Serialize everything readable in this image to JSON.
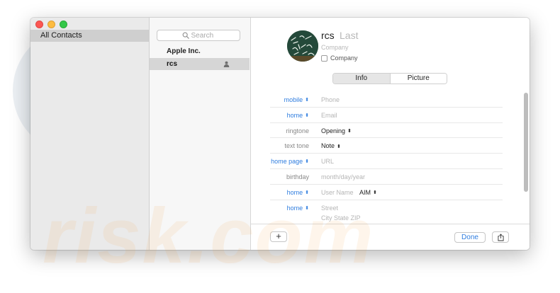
{
  "sidebar": {
    "items": [
      {
        "label": "All Contacts"
      }
    ]
  },
  "list": {
    "search_placeholder": "Search",
    "group_header": "Apple Inc.",
    "selected_contact": "rcs"
  },
  "card": {
    "first_name": "rcs",
    "last_name_placeholder": "Last",
    "company_placeholder": "Company",
    "company_checkbox_label": "Company",
    "tabs": [
      {
        "label": "Info"
      },
      {
        "label": "Picture"
      }
    ],
    "fields": [
      {
        "label": "mobile",
        "value": "Phone"
      },
      {
        "label": "home",
        "value": "Email"
      },
      {
        "label": "ringtone",
        "value": "Opening"
      },
      {
        "label": "text tone",
        "value": "Note"
      },
      {
        "label": "home page",
        "value": "URL"
      },
      {
        "label": "birthday",
        "value": "month/day/year"
      },
      {
        "label": "home",
        "value": "User Name",
        "extra": "AIM"
      },
      {
        "label": "home",
        "value": "Street",
        "value2": "City State ZIP"
      }
    ]
  },
  "toolbar": {
    "add_label": "+",
    "done_label": "Done"
  },
  "icons": {
    "search": "magnifier-icon",
    "person": "person-icon",
    "share": "share-icon"
  },
  "colors": {
    "accent": "#2f7ddf",
    "selection": "#d6d6d6",
    "sidebar_bg": "#eaeaea"
  },
  "watermark": "risk.com"
}
